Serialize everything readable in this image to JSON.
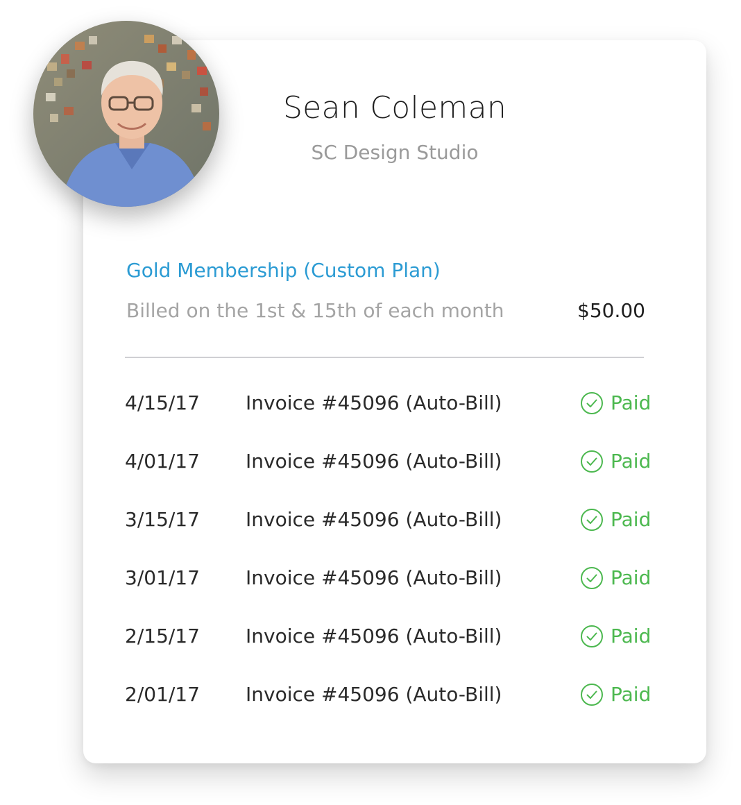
{
  "profile": {
    "name": "Sean Coleman",
    "company": "SC Design Studio",
    "avatar_icon": "user-photo"
  },
  "plan": {
    "name": "Gold Membership (Custom Plan)",
    "billing_schedule": "Billed on the 1st & 15th of each month",
    "amount": "$50.00"
  },
  "colors": {
    "accent": "#2b9bd3",
    "paid": "#4cb84f",
    "text": "#1f1f1f",
    "muted": "#9a9a9a"
  },
  "invoices": [
    {
      "date": "4/15/17",
      "title": "Invoice #45096 (Auto-Bill)",
      "status": "Paid",
      "status_icon": "check-circle-icon"
    },
    {
      "date": "4/01/17",
      "title": "Invoice #45096 (Auto-Bill)",
      "status": "Paid",
      "status_icon": "check-circle-icon"
    },
    {
      "date": "3/15/17",
      "title": "Invoice #45096 (Auto-Bill)",
      "status": "Paid",
      "status_icon": "check-circle-icon"
    },
    {
      "date": "3/01/17",
      "title": "Invoice #45096 (Auto-Bill)",
      "status": "Paid",
      "status_icon": "check-circle-icon"
    },
    {
      "date": "2/15/17",
      "title": "Invoice #45096 (Auto-Bill)",
      "status": "Paid",
      "status_icon": "check-circle-icon"
    },
    {
      "date": "2/01/17",
      "title": "Invoice #45096 (Auto-Bill)",
      "status": "Paid",
      "status_icon": "check-circle-icon"
    }
  ]
}
